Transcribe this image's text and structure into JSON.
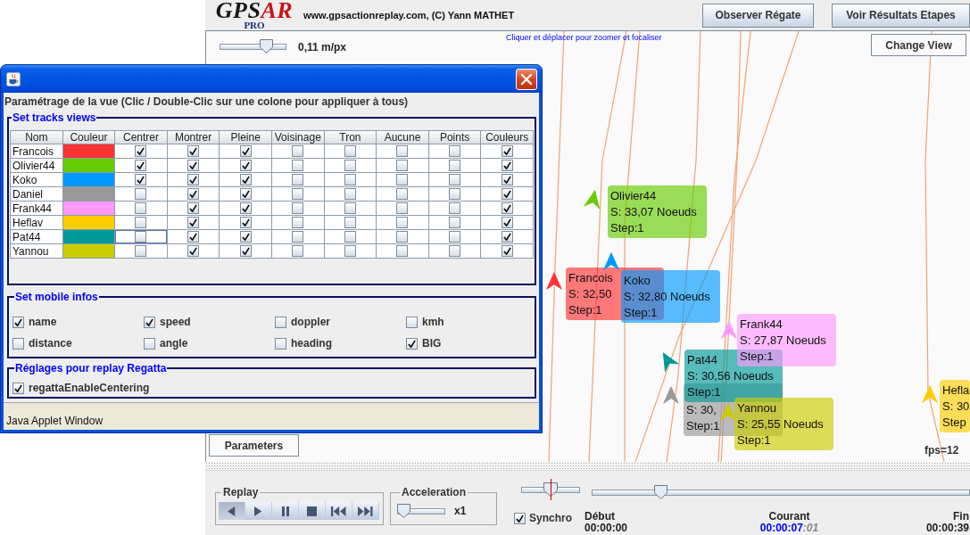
{
  "header": {
    "logo": {
      "dark": "GPS",
      "accent": "AR",
      "sub": "PRO"
    },
    "credit": "www.gpsactionreplay.com, (C) Yann MATHET",
    "buttons": [
      "Observer Régate",
      "Voir Résultats Etapes"
    ]
  },
  "map": {
    "zoom_slider": {
      "level": 0.75
    },
    "scale": "0,11 m/px",
    "hint": "Cliquer et déplacer pour zoomer et focaliser",
    "change_view": "Change View",
    "boats": [
      {
        "name": "Olivier44",
        "speed": "S: 33,07 Noeuds",
        "step": "Step:1",
        "color": "#66cc00"
      },
      {
        "name": "Francois",
        "speed": "S: 32,50",
        "step": "Step:1",
        "color": "#ff3333"
      },
      {
        "name": "Koko",
        "speed": "S: 32,80 Noeuds",
        "step": "Step:1",
        "color": "#0099ff"
      },
      {
        "name": "Frank44",
        "speed": "S: 27,87 Noeuds",
        "step": "Step:1",
        "color": "#ff99ff"
      },
      {
        "name": "Pat44",
        "speed": "S: 30,56 Noeuds",
        "step": "Step:1",
        "color": "#009999"
      },
      {
        "speed": "S: 30,",
        "step": "Step:1",
        "color": "#999999"
      },
      {
        "name": "Yannou",
        "speed": "S: 25,55 Noeuds",
        "step": "Step:1",
        "color": "#cccc00"
      },
      {
        "name": "Hefla",
        "speed": "S: 30",
        "step": "Step",
        "color": "#ffcc00"
      }
    ],
    "parameters": "Parameters",
    "fps": "fps=12"
  },
  "dialog": {
    "heading": "Paramétrage de la vue (Clic / Double-Clic sur une colone pour appliquer à tous)",
    "tracks": {
      "title": "Set tracks views",
      "columns": [
        "Nom",
        "Couleur",
        "Centrer",
        "Montrer",
        "Pleine",
        "Voisinage",
        "Tron",
        "Aucune",
        "Points",
        "Couleurs"
      ],
      "rows": [
        {
          "name": "Francois",
          "color": "#ff3333",
          "cells": [
            {
              "checked": true,
              "focused": false
            },
            {
              "checked": true,
              "focused": false
            },
            {
              "checked": true,
              "focused": false
            },
            {
              "checked": false,
              "focused": false
            },
            {
              "checked": false,
              "focused": false
            },
            {
              "checked": false,
              "focused": false
            },
            {
              "checked": false,
              "focused": false
            },
            {
              "checked": true,
              "focused": false
            }
          ]
        },
        {
          "name": "Olivier44",
          "color": "#66cc00",
          "cells": [
            {
              "checked": true,
              "focused": false
            },
            {
              "checked": true,
              "focused": false
            },
            {
              "checked": true,
              "focused": false
            },
            {
              "checked": false,
              "focused": false
            },
            {
              "checked": false,
              "focused": false
            },
            {
              "checked": false,
              "focused": false
            },
            {
              "checked": false,
              "focused": false
            },
            {
              "checked": true,
              "focused": false
            }
          ]
        },
        {
          "name": "Koko",
          "color": "#0099ff",
          "cells": [
            {
              "checked": true,
              "focused": false
            },
            {
              "checked": true,
              "focused": false
            },
            {
              "checked": true,
              "focused": false
            },
            {
              "checked": false,
              "focused": false
            },
            {
              "checked": false,
              "focused": false
            },
            {
              "checked": false,
              "focused": false
            },
            {
              "checked": false,
              "focused": false
            },
            {
              "checked": true,
              "focused": false
            }
          ]
        },
        {
          "name": "Daniel",
          "color": "#999999",
          "cells": [
            {
              "checked": false,
              "focused": false
            },
            {
              "checked": true,
              "focused": false
            },
            {
              "checked": true,
              "focused": false
            },
            {
              "checked": false,
              "focused": false
            },
            {
              "checked": false,
              "focused": false
            },
            {
              "checked": false,
              "focused": false
            },
            {
              "checked": false,
              "focused": false
            },
            {
              "checked": true,
              "focused": false
            }
          ]
        },
        {
          "name": "Frank44",
          "color": "#ff99ff",
          "cells": [
            {
              "checked": false,
              "focused": false
            },
            {
              "checked": true,
              "focused": false
            },
            {
              "checked": true,
              "focused": false
            },
            {
              "checked": false,
              "focused": false
            },
            {
              "checked": false,
              "focused": false
            },
            {
              "checked": false,
              "focused": false
            },
            {
              "checked": false,
              "focused": false
            },
            {
              "checked": true,
              "focused": false
            }
          ]
        },
        {
          "name": "Heflav",
          "color": "#ffcc00",
          "cells": [
            {
              "checked": false,
              "focused": false
            },
            {
              "checked": true,
              "focused": false
            },
            {
              "checked": true,
              "focused": false
            },
            {
              "checked": false,
              "focused": false
            },
            {
              "checked": false,
              "focused": false
            },
            {
              "checked": false,
              "focused": false
            },
            {
              "checked": false,
              "focused": false
            },
            {
              "checked": true,
              "focused": false
            }
          ]
        },
        {
          "name": "Pat44",
          "color": "#009999",
          "cells": [
            {
              "checked": false,
              "focused": true
            },
            {
              "checked": true,
              "focused": false
            },
            {
              "checked": true,
              "focused": false
            },
            {
              "checked": false,
              "focused": false
            },
            {
              "checked": false,
              "focused": false
            },
            {
              "checked": false,
              "focused": false
            },
            {
              "checked": false,
              "focused": false
            },
            {
              "checked": true,
              "focused": false
            }
          ]
        },
        {
          "name": "Yannou",
          "color": "#cccc00",
          "cells": [
            {
              "checked": false,
              "focused": false
            },
            {
              "checked": true,
              "focused": false
            },
            {
              "checked": true,
              "focused": false
            },
            {
              "checked": false,
              "focused": false
            },
            {
              "checked": false,
              "focused": false
            },
            {
              "checked": false,
              "focused": false
            },
            {
              "checked": false,
              "focused": false
            },
            {
              "checked": true,
              "focused": false
            }
          ]
        }
      ]
    },
    "mobile_infos": {
      "title": "Set mobile infos",
      "options": [
        {
          "label": "name",
          "checked": true
        },
        {
          "label": "speed",
          "checked": true
        },
        {
          "label": "doppler",
          "checked": false
        },
        {
          "label": "kmh",
          "checked": false
        },
        {
          "label": "distance",
          "checked": false
        },
        {
          "label": "angle",
          "checked": false
        },
        {
          "label": "heading",
          "checked": false
        },
        {
          "label": "BIG",
          "checked": true
        }
      ]
    },
    "regatta": {
      "title": "Réglages pour replay Regatta",
      "options": [
        {
          "label": "regattaEnableCentering",
          "checked": true
        }
      ]
    },
    "status": "Java Applet Window"
  },
  "controls": {
    "replay": {
      "title": "Replay",
      "buttons": [
        {
          "kind": "step_back",
          "pressed": true
        },
        {
          "kind": "play",
          "pressed": false
        },
        {
          "kind": "pause",
          "pressed": false
        },
        {
          "kind": "stop",
          "pressed": false
        },
        {
          "kind": "skip_back",
          "pressed": false
        },
        {
          "kind": "skip_forward",
          "pressed": false
        }
      ]
    },
    "acceleration": {
      "title": "Acceleration",
      "level": 0,
      "value": "x1"
    },
    "sync_slider": {
      "level": 0.5
    },
    "synchro": {
      "label": "Synchro",
      "checked": true
    },
    "timeline": {
      "level": 0.17
    },
    "times": [
      {
        "kind": "start",
        "label": "Début",
        "time": "00:00:00"
      },
      {
        "kind": "current",
        "label": "Courant",
        "time": "00:00:07",
        "frame": ":01"
      },
      {
        "kind": "end",
        "label": "Fin",
        "time": "00:00:39"
      }
    ]
  }
}
